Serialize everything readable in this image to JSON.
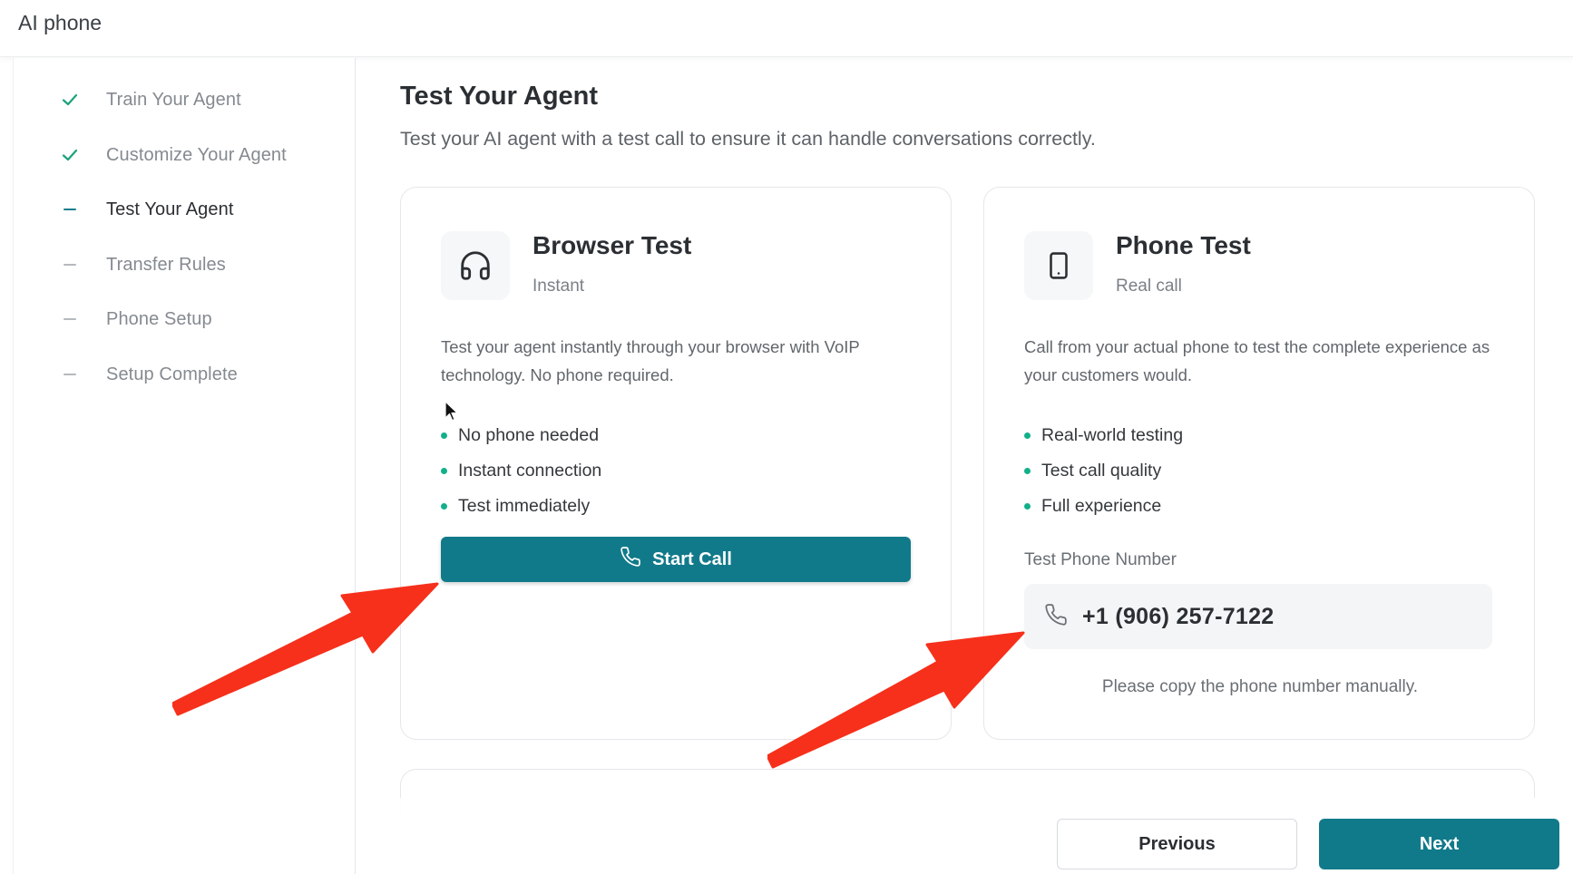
{
  "app": {
    "title": "AI phone"
  },
  "sidebar": {
    "steps": [
      {
        "label": "Train Your Agent",
        "status": "done"
      },
      {
        "label": "Customize Your Agent",
        "status": "done"
      },
      {
        "label": "Test Your Agent",
        "status": "current"
      },
      {
        "label": "Transfer Rules",
        "status": "pending"
      },
      {
        "label": "Phone Setup",
        "status": "pending"
      },
      {
        "label": "Setup Complete",
        "status": "pending"
      }
    ]
  },
  "main": {
    "title": "Test Your Agent",
    "subtitle": "Test your AI agent with a test call to ensure it can handle conversations correctly.",
    "browser_card": {
      "icon": "headphones-icon",
      "title": "Browser Test",
      "subtitle": "Instant",
      "description": "Test your agent instantly through your browser with VoIP technology. No phone required.",
      "features": [
        "No phone needed",
        "Instant connection",
        "Test immediately"
      ],
      "button_label": "Start Call"
    },
    "phone_card": {
      "icon": "smartphone-icon",
      "title": "Phone Test",
      "subtitle": "Real call",
      "description": "Call from your actual phone to test the complete experience as your customers would.",
      "features": [
        "Real-world testing",
        "Test call quality",
        "Full experience"
      ],
      "phone_label": "Test Phone Number",
      "phone_number": "+1 (906) 257-7122",
      "note": "Please copy the phone number manually."
    }
  },
  "footer": {
    "previous_label": "Previous",
    "next_label": "Next"
  },
  "colors": {
    "accent": "#117a8a",
    "check": "#1ba27b",
    "bullet": "#12b08a",
    "annotation_arrow": "#f6301b"
  }
}
